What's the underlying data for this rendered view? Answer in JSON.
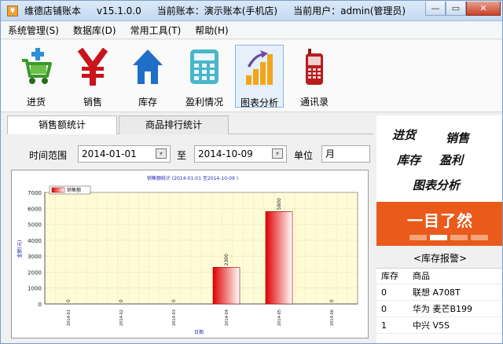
{
  "titlebar": {
    "app_name": "维德店铺账本",
    "version": "v15.1.0.0",
    "account": "当前账本：演示账本(手机店)",
    "user": "当前用户：admin(管理员)",
    "minimize": "—",
    "maximize": "▭",
    "close": "✕"
  },
  "menu": [
    "系统管理(S)",
    "数据库(D)",
    "常用工具(T)",
    "帮助(H)"
  ],
  "toolbar": [
    {
      "label": "进货",
      "icon": "cart-add-icon"
    },
    {
      "label": "销售",
      "icon": "yen-icon"
    },
    {
      "label": "库存",
      "icon": "house-icon"
    },
    {
      "label": "盈利情况",
      "icon": "calculator-icon"
    },
    {
      "label": "图表分析",
      "icon": "bar-chart-icon"
    },
    {
      "label": "通讯录",
      "icon": "mobile-phone-icon"
    }
  ],
  "tabs": [
    {
      "label": "销售额统计",
      "active": true
    },
    {
      "label": "商品排行统计",
      "active": false
    }
  ],
  "filters": {
    "range_label": "时间范围",
    "start_date": "2014-01-01",
    "to_label": "至",
    "end_date": "2014-10-09",
    "unit_label": "单位",
    "unit_value": "月"
  },
  "chart_data": {
    "type": "bar",
    "title": "销售额统计 (2014-01-01 至2014-10-09 )",
    "xlabel": "日期",
    "ylabel": "金额(元)",
    "ylim": [
      0,
      7000
    ],
    "yticks": [
      0,
      1000,
      2000,
      3000,
      4000,
      5000,
      6000,
      7000
    ],
    "categories": [
      "2014-01",
      "2014-02",
      "2014-03",
      "2014-04",
      "2014-05",
      "2014-06"
    ],
    "series": [
      {
        "name": "销售额",
        "values": [
          0,
          0,
          0,
          2300,
          5800,
          0
        ]
      }
    ],
    "data_labels": [
      "0",
      "0",
      "0",
      "2300",
      "5800",
      "0"
    ],
    "legend": "top-left",
    "grid": true,
    "colors": {
      "bar_dark": "#e00000",
      "bar_light": "#ffffff",
      "plot_bg": "#fffbd6"
    }
  },
  "promo": {
    "words": [
      "进货",
      "销售",
      "库存",
      "盈利",
      "图表分析"
    ],
    "slogan": "一目了然",
    "band_color": "#e95a1b"
  },
  "stock": {
    "title": "<库存报警>",
    "headers": [
      "库存",
      "商品"
    ],
    "rows": [
      {
        "qty": "0",
        "name": "联想 A708T"
      },
      {
        "qty": "0",
        "name": "华为 麦芒B199"
      },
      {
        "qty": "1",
        "name": "中兴 V5S"
      }
    ]
  }
}
